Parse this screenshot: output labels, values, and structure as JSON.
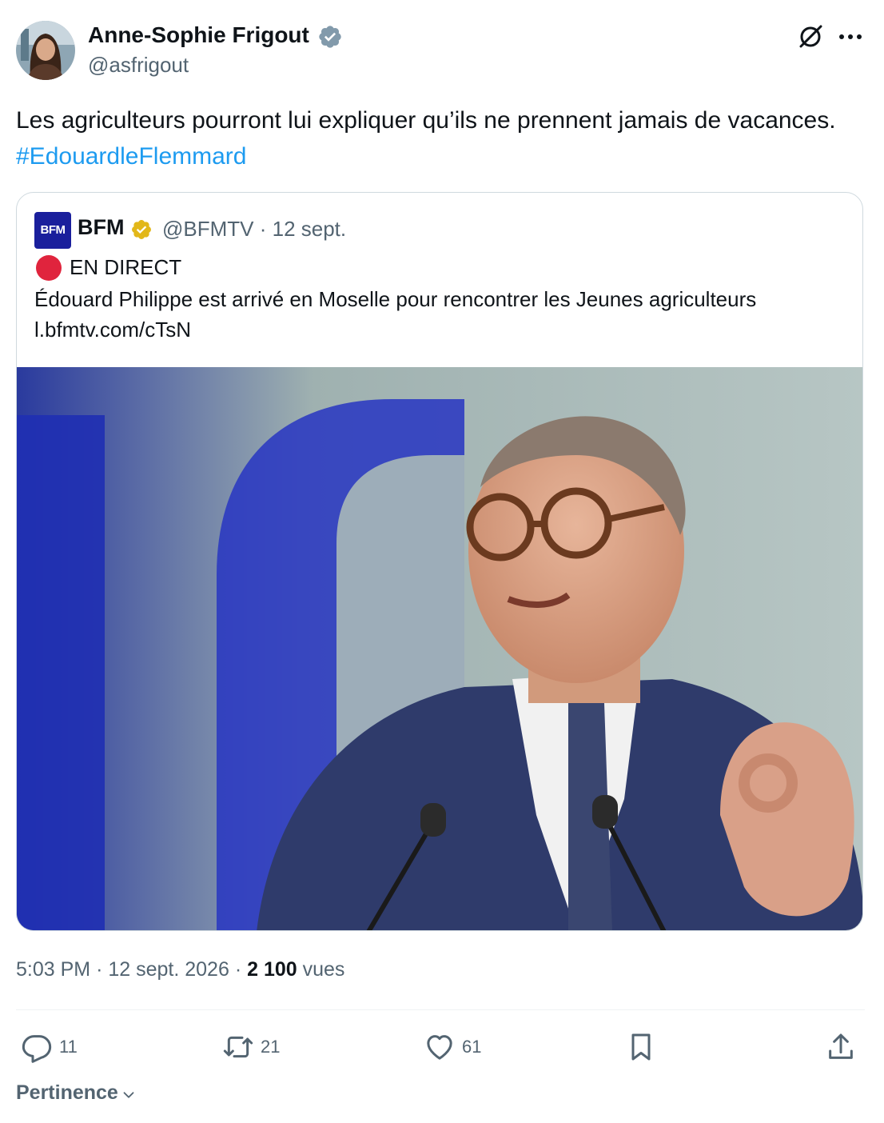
{
  "author": {
    "name": "Anne-Sophie Frigout",
    "handle": "@asfrigout",
    "verified": true
  },
  "tweet": {
    "text": "Les agriculteurs pourront lui expliquer qu’ils ne prennent jamais de vacances.",
    "hashtag": "#EdouardleFlemmard"
  },
  "quote": {
    "logo_text": "BFM",
    "name": "BFM",
    "handle_date": "@BFMTV · 12 sept.",
    "live_label": "EN DIRECT",
    "body": "Édouard Philippe est arrivé en Moselle pour rencontrer les Jeunes agriculteurs",
    "link": "l.bfmtv.com/cTsN",
    "photo_icon": "photo-man-speaking-at-podium"
  },
  "meta": {
    "time": "5:03 PM",
    "date": "12 sept. 2026",
    "views_count": "2 100",
    "views_label": "vues"
  },
  "actions": {
    "replies": "11",
    "retweets": "21",
    "likes": "61"
  },
  "sort_label": "Pertinence",
  "colors": {
    "link": "#1d9bf0",
    "secondary_text": "#536471",
    "verified_blue": "#829aab",
    "verified_gold": "#e2b719",
    "live_red": "#e0243d"
  }
}
